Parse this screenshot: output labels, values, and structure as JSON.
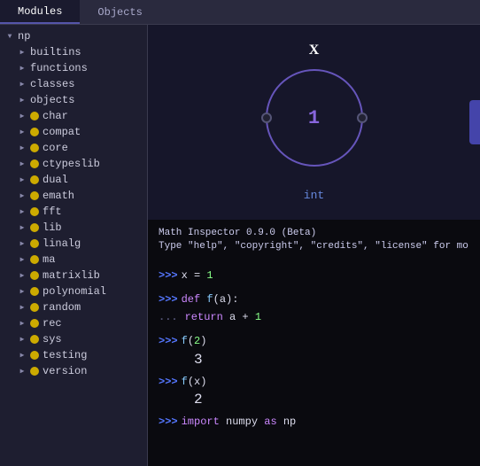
{
  "tabs": [
    {
      "id": "modules",
      "label": "Modules",
      "active": true
    },
    {
      "id": "objects",
      "label": "Objects",
      "active": false
    }
  ],
  "sidebar": {
    "items": [
      {
        "id": "np",
        "label": "np",
        "level": 0,
        "arrow": "down",
        "icon": null
      },
      {
        "id": "builtins",
        "label": "builtins",
        "level": 1,
        "arrow": "right",
        "icon": null
      },
      {
        "id": "functions",
        "label": "functions",
        "level": 1,
        "arrow": "right",
        "icon": null
      },
      {
        "id": "classes",
        "label": "classes",
        "level": 1,
        "arrow": "right",
        "icon": null
      },
      {
        "id": "objects",
        "label": "objects",
        "level": 1,
        "arrow": "right",
        "icon": null
      },
      {
        "id": "char",
        "label": "char",
        "level": 1,
        "arrow": "right",
        "icon": "yellow"
      },
      {
        "id": "compat",
        "label": "compat",
        "level": 1,
        "arrow": "right",
        "icon": "yellow"
      },
      {
        "id": "core",
        "label": "core",
        "level": 1,
        "arrow": "right",
        "icon": "yellow"
      },
      {
        "id": "ctypeslib",
        "label": "ctypeslib",
        "level": 1,
        "arrow": "right",
        "icon": "yellow"
      },
      {
        "id": "dual",
        "label": "dual",
        "level": 1,
        "arrow": "right",
        "icon": "yellow"
      },
      {
        "id": "emath",
        "label": "emath",
        "level": 1,
        "arrow": "right",
        "icon": "yellow"
      },
      {
        "id": "fft",
        "label": "fft",
        "level": 1,
        "arrow": "right",
        "icon": "yellow"
      },
      {
        "id": "lib",
        "label": "lib",
        "level": 1,
        "arrow": "right",
        "icon": "yellow"
      },
      {
        "id": "linalg",
        "label": "linalg",
        "level": 1,
        "arrow": "right",
        "icon": "yellow"
      },
      {
        "id": "ma",
        "label": "ma",
        "level": 1,
        "arrow": "right",
        "icon": "yellow"
      },
      {
        "id": "matrixlib",
        "label": "matrixlib",
        "level": 1,
        "arrow": "right",
        "icon": "yellow"
      },
      {
        "id": "polynomial",
        "label": "polynomial",
        "level": 1,
        "arrow": "right",
        "icon": "yellow"
      },
      {
        "id": "random",
        "label": "random",
        "level": 1,
        "arrow": "right",
        "icon": "yellow"
      },
      {
        "id": "rec",
        "label": "rec",
        "level": 1,
        "arrow": "right",
        "icon": "yellow"
      },
      {
        "id": "sys",
        "label": "sys",
        "level": 1,
        "arrow": "right",
        "icon": "yellow"
      },
      {
        "id": "testing",
        "label": "testing",
        "level": 1,
        "arrow": "right",
        "icon": "yellow"
      },
      {
        "id": "version",
        "label": "version",
        "level": 1,
        "arrow": "right",
        "icon": "yellow"
      }
    ]
  },
  "canvas": {
    "node_label": "X",
    "node_value": "1",
    "type_label": "int"
  },
  "terminal": {
    "header_line1": "Math Inspector 0.9.0 (Beta)",
    "header_line2": "Type \"help\", \"copyright\", \"credits\", \"license\" for mo",
    "lines": [
      {
        "prompt": ">>>",
        "code": "x = 1",
        "type": "input"
      },
      {
        "prompt": ">>>",
        "code": "def f(a):",
        "type": "input"
      },
      {
        "prompt": "...",
        "code": "    return a + 1",
        "type": "continue"
      },
      {
        "prompt": ">>>",
        "code": "f(2)",
        "type": "input"
      },
      {
        "output": "3",
        "type": "output"
      },
      {
        "prompt": ">>>",
        "code": "f(x)",
        "type": "input"
      },
      {
        "output": "2",
        "type": "output"
      },
      {
        "prompt": ">>>",
        "code": "import numpy as np",
        "type": "input"
      }
    ]
  }
}
